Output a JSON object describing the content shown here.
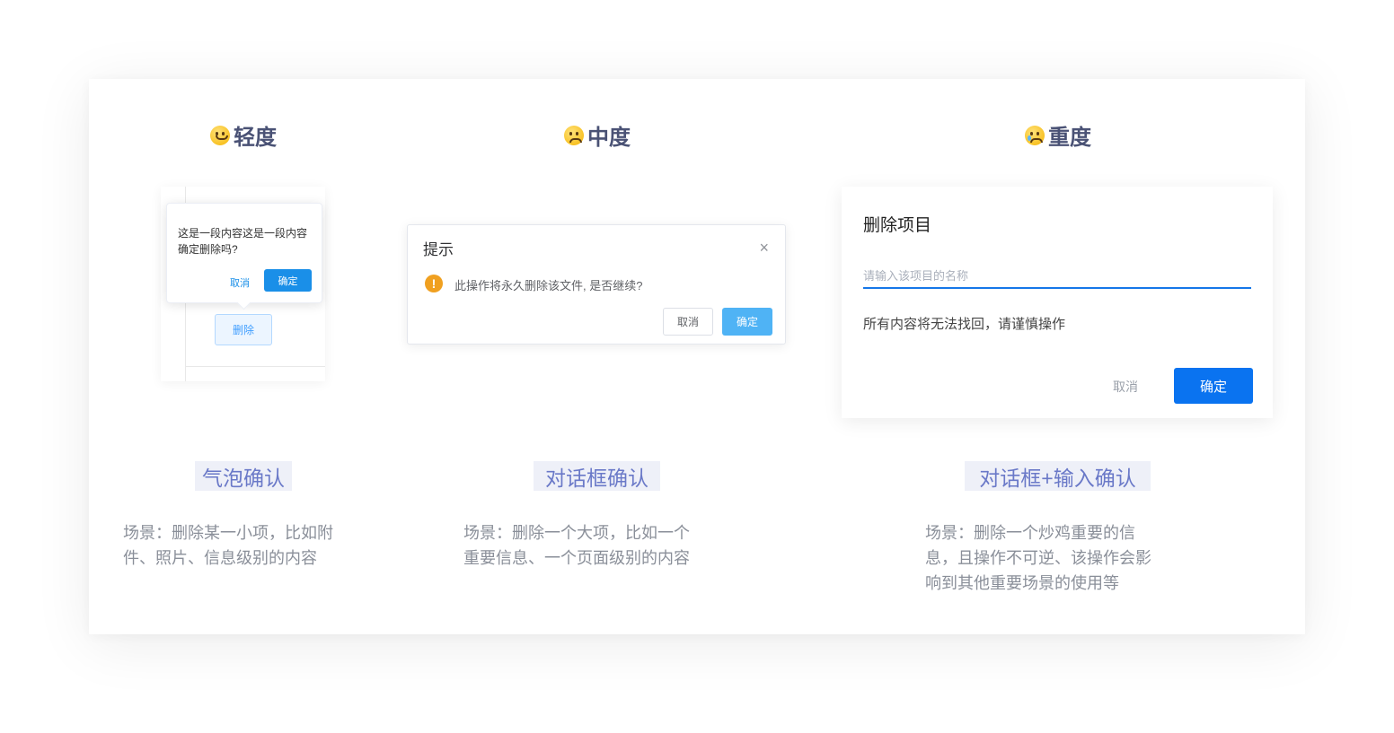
{
  "levels": {
    "light": "轻度",
    "medium": "中度",
    "heavy": "重度"
  },
  "bubble": {
    "text": "这是一段内容这是一段内容确定删除吗?",
    "cancel": "取消",
    "confirm": "确定",
    "delete_button": "删除"
  },
  "dialog": {
    "title": "提示",
    "close": "×",
    "warn": "!",
    "message": "此操作将永久删除该文件, 是否继续?",
    "cancel": "取消",
    "confirm": "确定"
  },
  "modal": {
    "title": "删除项目",
    "input_placeholder": "请输入该项目的名称",
    "message": "所有内容将无法找回，请谨慎操作",
    "cancel": "取消",
    "confirm": "确定"
  },
  "tags": {
    "bubble": "气泡确认",
    "dialog": "对话框确认",
    "input": "对话框+输入确认"
  },
  "descriptions": {
    "bubble_l1": "场景：删除某一小项，比如附",
    "bubble_l2": "件、照片、信息级别的内容",
    "dialog_l1": "场景：删除一个大项，比如一个",
    "dialog_l2": "重要信息、一个页面级别的内容",
    "input_l1": "场景：删除一个炒鸡重要的信",
    "input_l2": "息，且操作不可逆、该操作会影",
    "input_l3": "响到其他重要场景的使用等"
  }
}
